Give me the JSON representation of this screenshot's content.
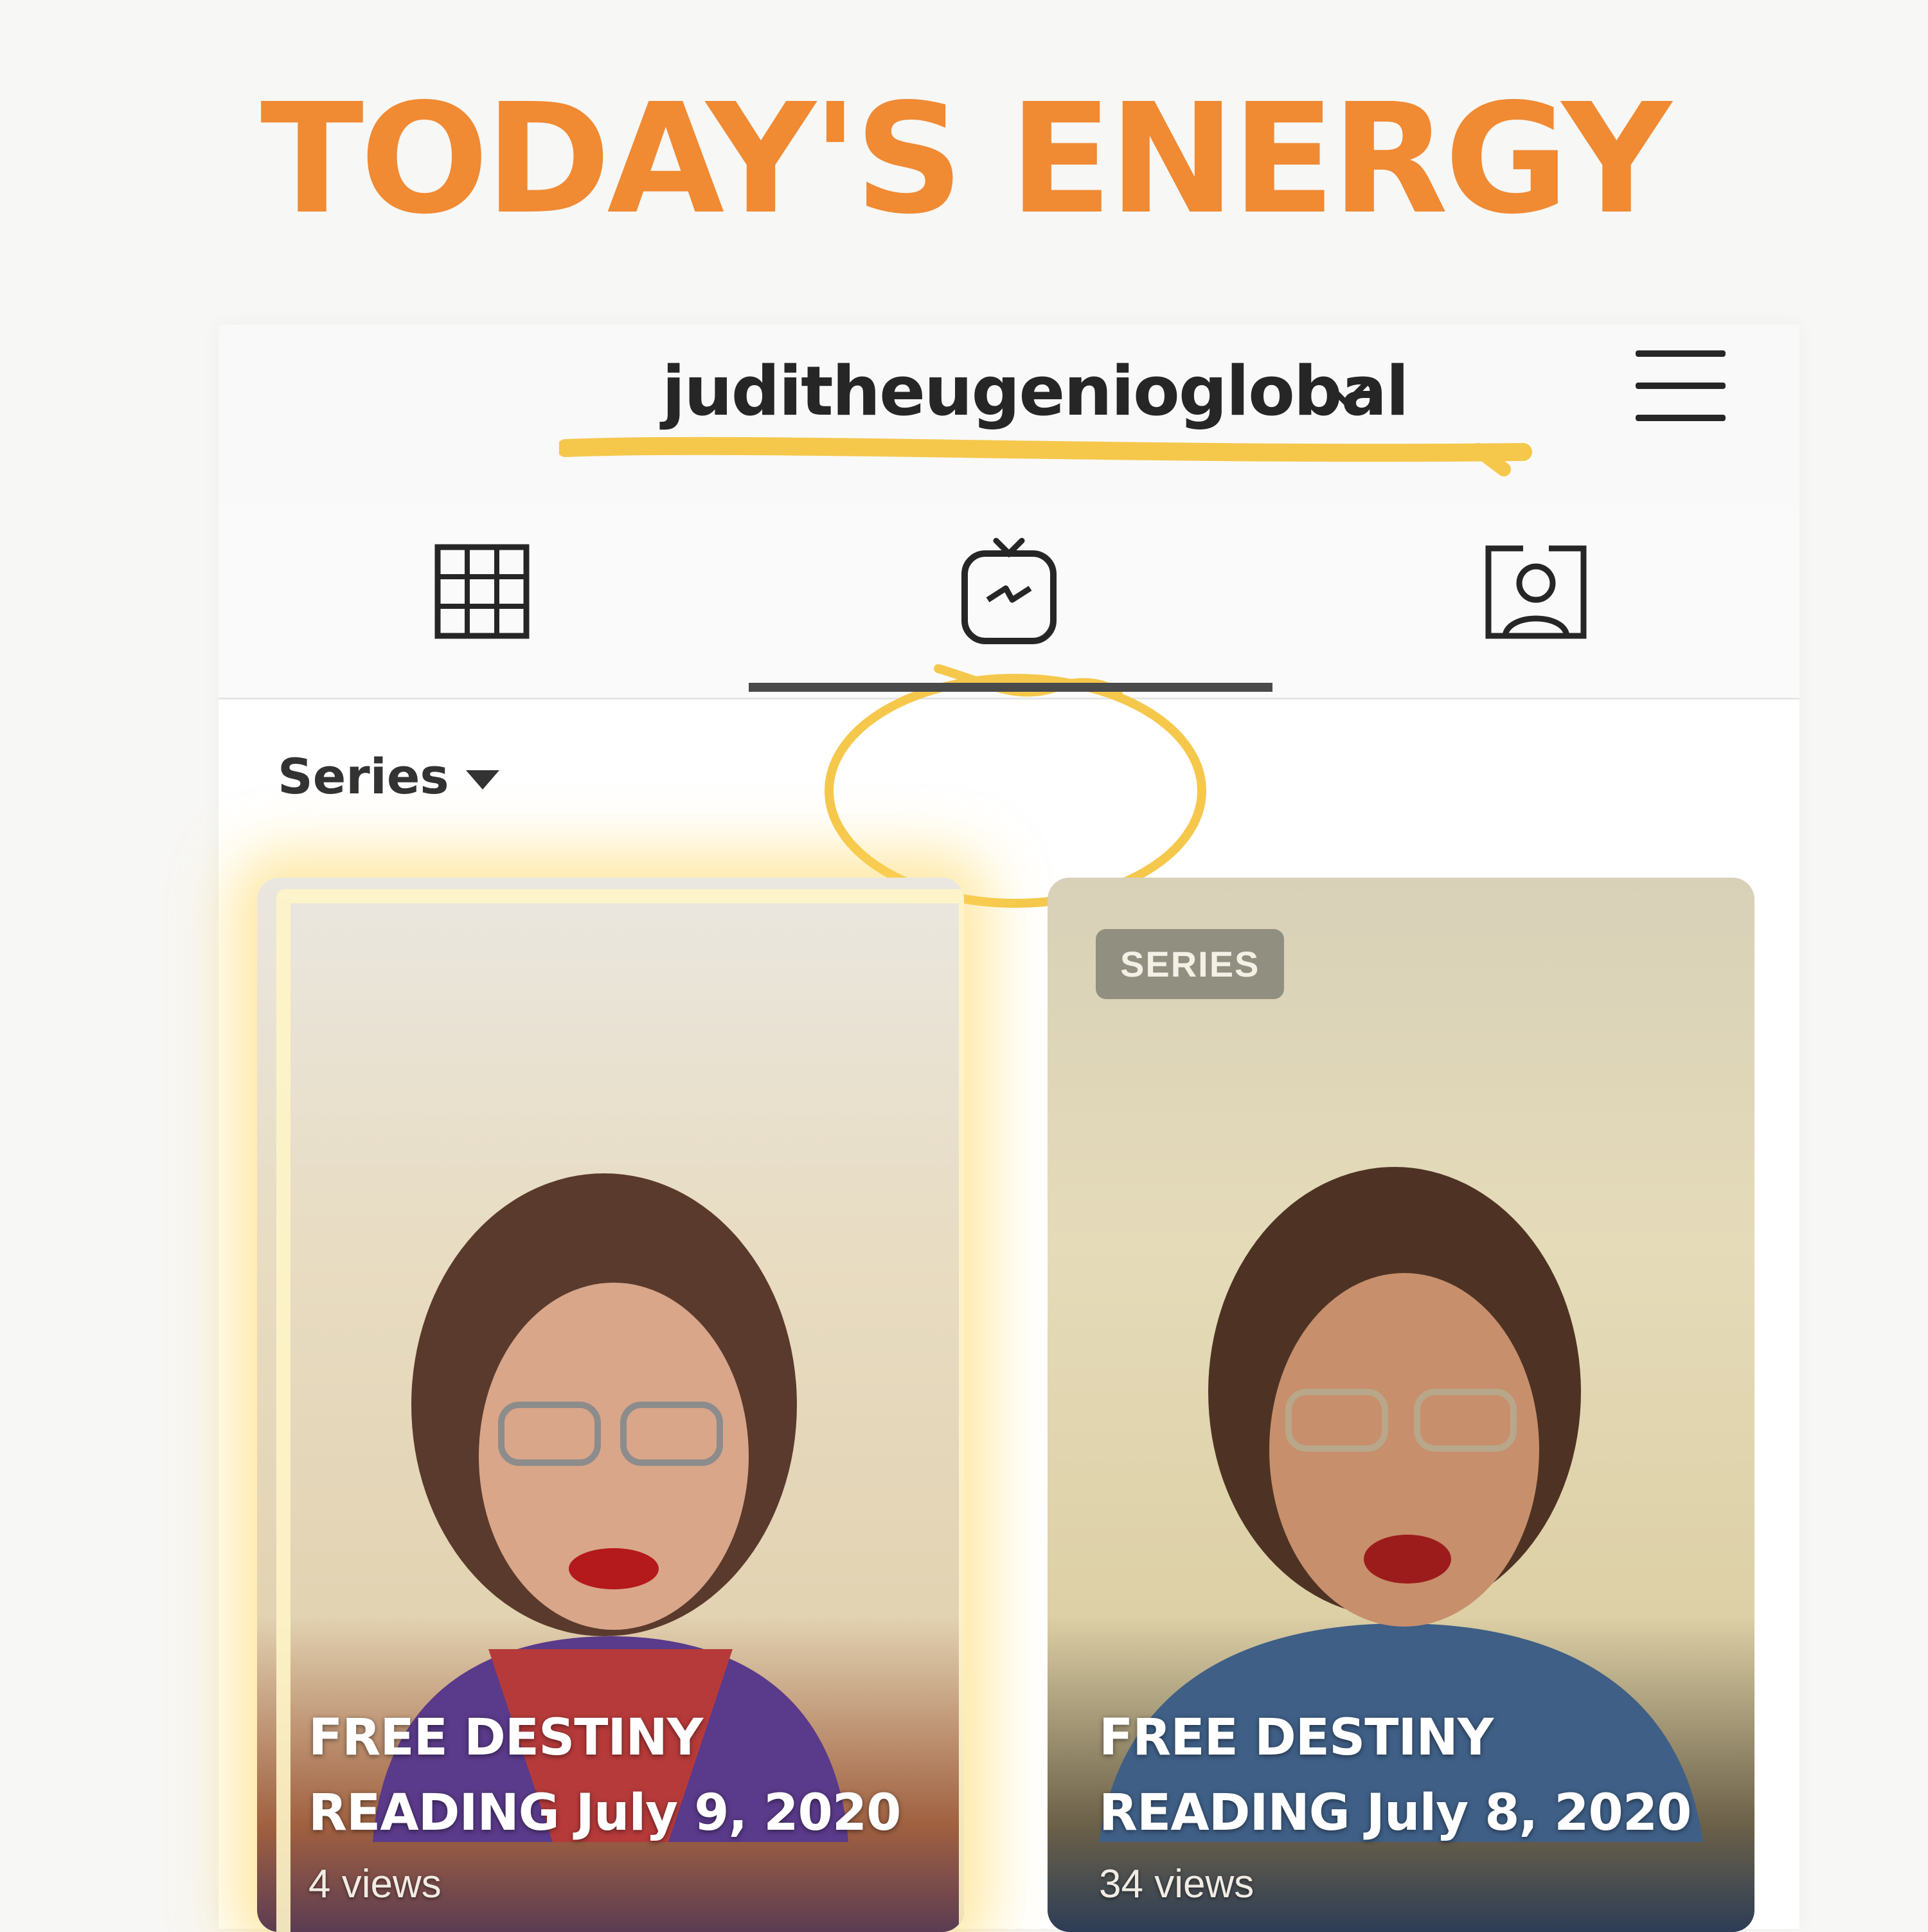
{
  "headline": "TODAY'S ENERGY",
  "header": {
    "username": "juditheugenioglobal"
  },
  "tabs": [
    {
      "name": "grid",
      "icon": "grid-icon",
      "active": false
    },
    {
      "name": "igtv",
      "icon": "igtv-icon",
      "active": true
    },
    {
      "name": "tagged",
      "icon": "tagged-icon",
      "active": false
    }
  ],
  "filter": {
    "label": "Series"
  },
  "videos": [
    {
      "badge": "",
      "title_line1": "FREE DESTINY",
      "title_line2": "READING July 9, 2020",
      "views": "4 views"
    },
    {
      "badge": "SERIES",
      "title_line1": "FREE DESTINY",
      "title_line2": "READING July 8, 2020",
      "views": "34 views"
    }
  ],
  "colors": {
    "accent": "#f08a33",
    "highlight": "#f5c84c",
    "text": "#262626"
  }
}
